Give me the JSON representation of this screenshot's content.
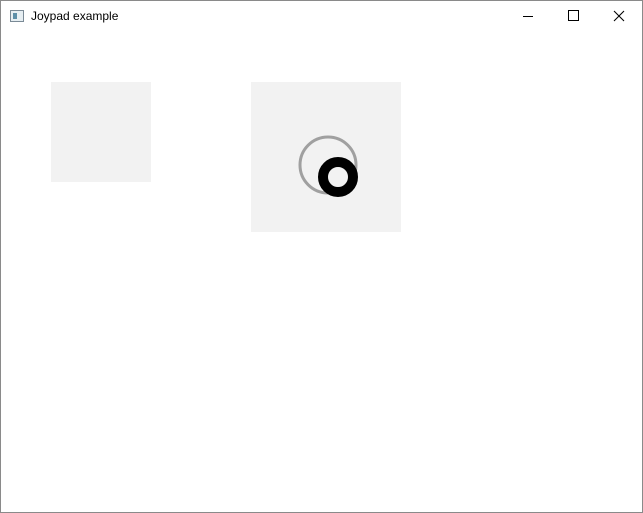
{
  "window": {
    "title": "Joypad example",
    "app_icon": "window-app-icon",
    "controls": [
      "minimize-icon",
      "maximize-icon",
      "close-icon"
    ]
  },
  "joypads": {
    "colors": {
      "pad_background": "#f2f2f2",
      "center_ring": "#a0a0a0",
      "knob": "#000000",
      "knob_hole": "#ffffff"
    }
  }
}
